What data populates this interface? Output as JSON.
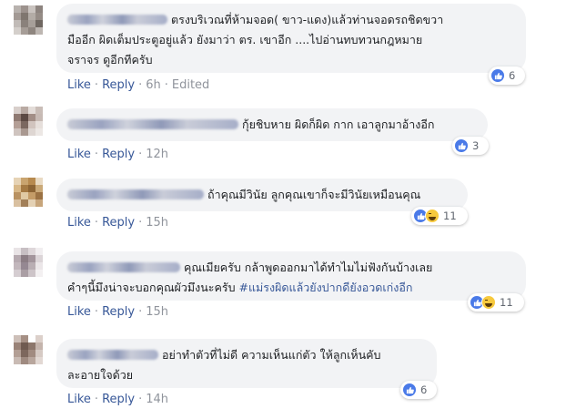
{
  "comments": [
    {
      "text": "ตรงบริเวณที่ห้ามจอด( ขาว-แดง)แล้วท่านจอดรถชิดขวา\nมืออีก ผิดเต็มประตูอยู่แล้ว ยังมาว่า ตร. เขาอีก ....ไปอ่านทบทวนกฎหมาย\nจราจร ดูอีกทีครับ",
      "like": "Like",
      "reply": "Reply",
      "time": "6h",
      "edited": "Edited",
      "reactions": [
        "like-icon"
      ],
      "reaction_count": "6"
    },
    {
      "text": "กุ้ยชิบหาย ผิดก็ผิด กาก เอาลูกมาอ้างอีก",
      "like": "Like",
      "reply": "Reply",
      "time": "12h",
      "reactions": [
        "like-icon"
      ],
      "reaction_count": "3"
    },
    {
      "text": "ถ้าคุณมีวินัย ลูกคุณเขาก็จะมีวินัยเหมือนคุณ",
      "like": "Like",
      "reply": "Reply",
      "time": "15h",
      "reactions": [
        "like-icon",
        "haha-icon"
      ],
      "reaction_count": "11"
    },
    {
      "text": "คุณเมียครับ กล้าพูดออกมาได้ทำไมไม่ฟังกันบ้างเลย\nคำๆนี้มึงน่าจะบอกคุณผัวมึงนะครับ ",
      "hashtag": "#แม่รงผิดแล้วยังปากดียังอวดเก่งอีก",
      "like": "Like",
      "reply": "Reply",
      "time": "15h",
      "reactions": [
        "like-icon",
        "haha-icon"
      ],
      "reaction_count": "11"
    },
    {
      "text": "อย่าทำตัวที่ไม่ดี ความเห็นแก่ตัว ให้ลูกเห็นคับ\nละอายใจด้วย",
      "like": "Like",
      "reply": "Reply",
      "time": "14h",
      "reactions": [
        "like-icon"
      ],
      "reaction_count": "6"
    }
  ],
  "colors": {
    "link": "#385898",
    "bubble": "#f2f3f5",
    "meta": "#90949c",
    "like": "#4a7ae8"
  }
}
